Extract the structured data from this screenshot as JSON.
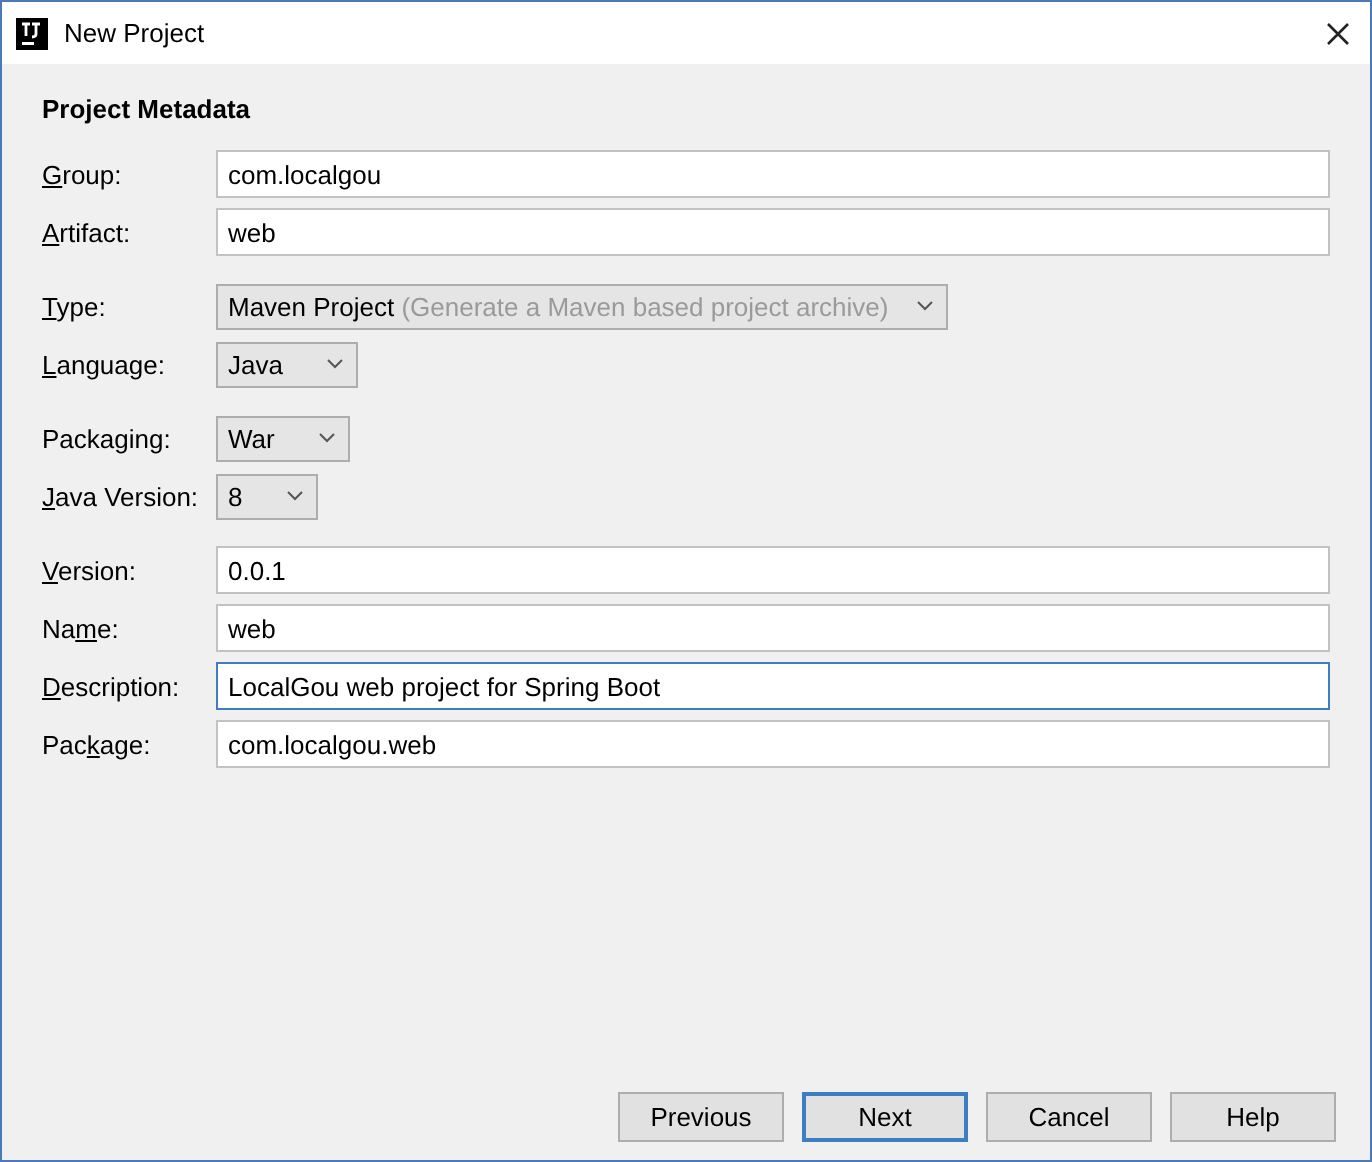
{
  "window": {
    "title": "New Project"
  },
  "section_title": "Project Metadata",
  "groups": [
    [
      {
        "kind": "text",
        "label": {
          "key": "G",
          "after": "roup:"
        },
        "value": "com.localgou",
        "focused": false
      },
      {
        "kind": "text",
        "label": {
          "key": "A",
          "after": "rtifact:"
        },
        "value": "web",
        "focused": false
      }
    ],
    [
      {
        "kind": "select",
        "label": {
          "key": "T",
          "after": "ype:"
        },
        "value": "Maven Project",
        "hint": "(Generate a Maven based project archive)"
      },
      {
        "kind": "select",
        "label": {
          "key": "L",
          "after": "anguage:"
        },
        "value": "Java"
      }
    ],
    [
      {
        "kind": "select",
        "label": {
          "before": "Packa",
          "key": "g",
          "after": "ing:"
        },
        "value": "War"
      },
      {
        "kind": "select",
        "label": {
          "key": "J",
          "after": "ava Version:"
        },
        "value": "8"
      }
    ],
    [
      {
        "kind": "text",
        "label": {
          "key": "V",
          "after": "ersion:"
        },
        "value": "0.0.1",
        "focused": false
      },
      {
        "kind": "text",
        "label": {
          "before": "Na",
          "key": "m",
          "after": "e:"
        },
        "value": "web",
        "focused": false
      },
      {
        "kind": "text",
        "label": {
          "key": "D",
          "after": "escription:"
        },
        "value": "LocalGou web project for Spring Boot",
        "focused": true
      },
      {
        "kind": "text",
        "label": {
          "before": "Pac",
          "key": "k",
          "after": "age:"
        },
        "value": "com.localgou.web",
        "focused": false
      }
    ]
  ],
  "buttons": [
    {
      "label": "Previous",
      "default": false
    },
    {
      "label": "Next",
      "default": true
    },
    {
      "label": "Cancel",
      "default": false
    },
    {
      "label": "Help",
      "default": false
    }
  ]
}
